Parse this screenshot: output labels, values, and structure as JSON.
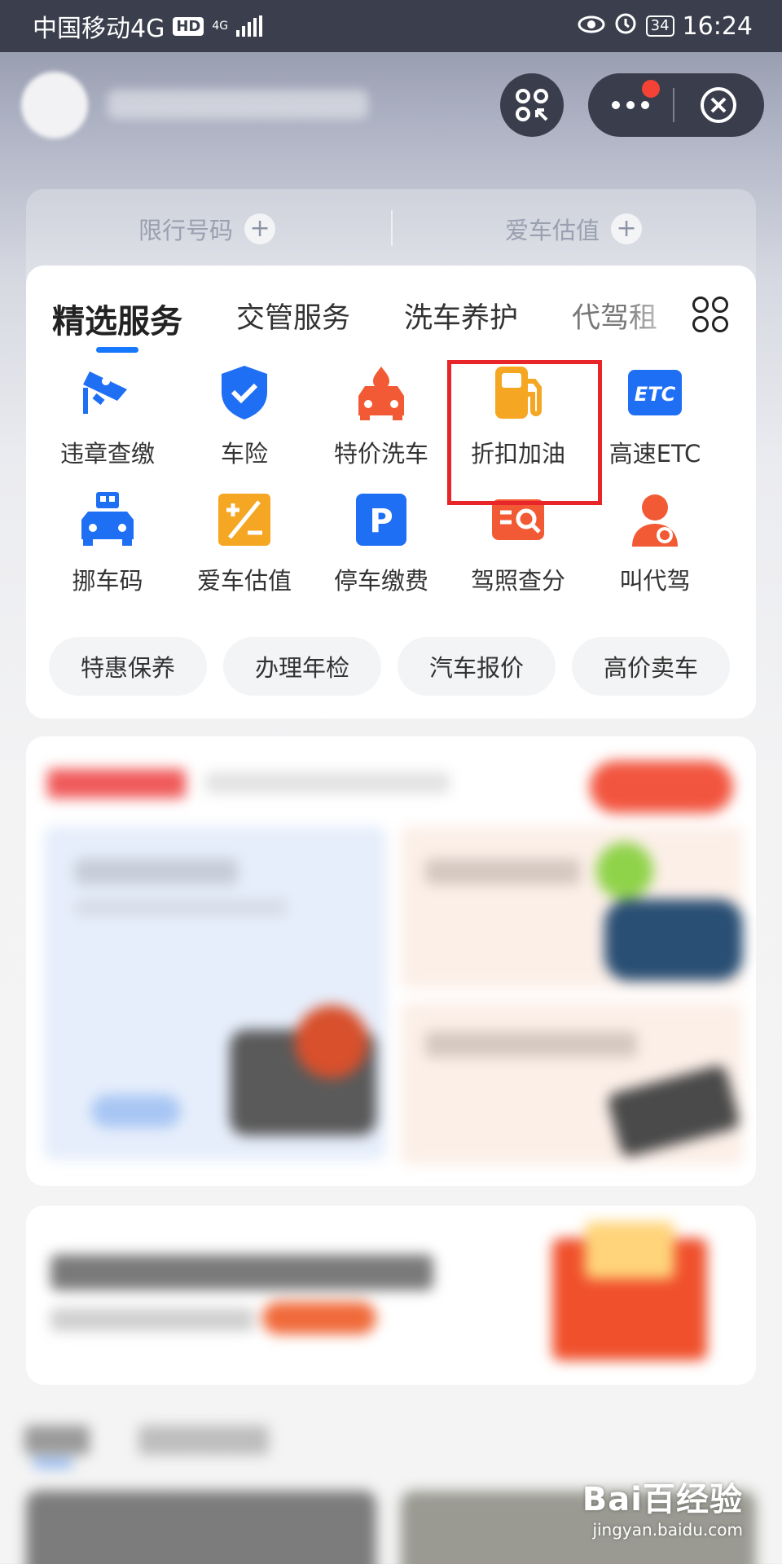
{
  "status_bar": {
    "carrier": "中国移动4G",
    "hd": "HD",
    "net": "4G",
    "battery": "34",
    "time": "16:24"
  },
  "quick_bar": {
    "left_label": "限行号码",
    "right_label": "爱车估值",
    "plus": "+"
  },
  "tabs": [
    {
      "label": "精选服务",
      "active": true
    },
    {
      "label": "交管服务",
      "active": false
    },
    {
      "label": "洗车养护",
      "active": false
    },
    {
      "label": "代驾租",
      "active": false
    }
  ],
  "services": [
    {
      "label": "违章查缴",
      "icon": "camera-icon",
      "color": "#1f6ff5"
    },
    {
      "label": "车险",
      "icon": "shield-check-icon",
      "color": "#1f6ff5"
    },
    {
      "label": "特价洗车",
      "icon": "car-wash-icon",
      "color": "#f25a35"
    },
    {
      "label": "折扣加油",
      "icon": "fuel-pump-icon",
      "color": "#f5a623"
    },
    {
      "label": "高速ETC",
      "icon": "etc-icon",
      "color": "#1f6ff5",
      "icon_text": "ETC"
    },
    {
      "label": "挪车码",
      "icon": "qr-car-icon",
      "color": "#1f6ff5"
    },
    {
      "label": "爱车估值",
      "icon": "plus-minus-icon",
      "color": "#f5a623"
    },
    {
      "label": "停车缴费",
      "icon": "parking-icon",
      "color": "#1f6ff5",
      "icon_text": "P"
    },
    {
      "label": "驾照查分",
      "icon": "license-search-icon",
      "color": "#f25a35"
    },
    {
      "label": "叫代驾",
      "icon": "driver-icon",
      "color": "#f25a35"
    }
  ],
  "chips": [
    "特惠保养",
    "办理年检",
    "汽车报价",
    "高价卖车"
  ],
  "watermark": {
    "brand": "Bai百经验",
    "url": "jingyan.baidu.com"
  }
}
